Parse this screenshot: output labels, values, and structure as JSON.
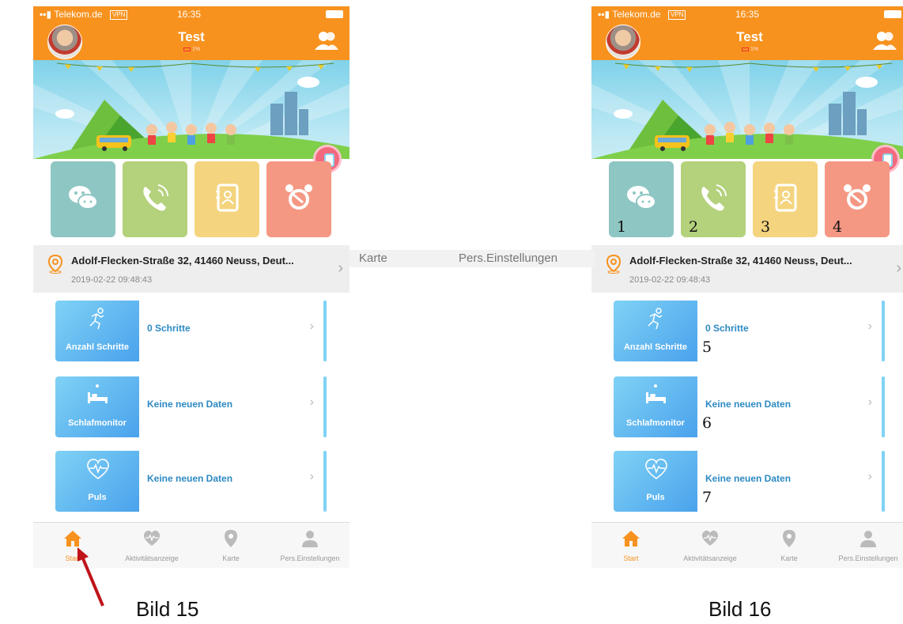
{
  "screens": [
    {
      "status_bar": {
        "carrier": "Telekom.de",
        "vpn": "VPN",
        "time": "16:35"
      },
      "header": {
        "title": "Test",
        "battery_text": "1%"
      },
      "tiles": [
        {
          "icon": "chat-icon",
          "num": ""
        },
        {
          "icon": "phone-icon",
          "num": ""
        },
        {
          "icon": "contacts-book-icon",
          "num": ""
        },
        {
          "icon": "alarm-clock-icon",
          "num": ""
        }
      ],
      "location": {
        "address": "Adolf-Flecken-Straße 32, 41460 Neuss, Deut...",
        "datetime": "2019-02-22 09:48:43"
      },
      "cards": [
        {
          "label": "Anzahl Schritte",
          "value": "0 Schritte",
          "icon": "running-icon",
          "num": ""
        },
        {
          "label": "Schlafmonitor",
          "value": "Keine neuen Daten",
          "icon": "bed-icon",
          "num": ""
        },
        {
          "label": "Puls",
          "value": "Keine neuen Daten",
          "icon": "heart-pulse-icon",
          "num": ""
        }
      ],
      "tabs": [
        "Start",
        "Aktivitätsanzeige",
        "Karte",
        "Pers.Einstellungen"
      ],
      "active_tab": "Start"
    },
    {
      "status_bar": {
        "carrier": "Telekom.de",
        "vpn": "VPN",
        "time": "16:35"
      },
      "header": {
        "title": "Test",
        "battery_text": "1%"
      },
      "tiles": [
        {
          "icon": "chat-icon",
          "num": "1"
        },
        {
          "icon": "phone-icon",
          "num": "2"
        },
        {
          "icon": "contacts-book-icon",
          "num": "3"
        },
        {
          "icon": "alarm-clock-icon",
          "num": "4"
        }
      ],
      "location": {
        "address": "Adolf-Flecken-Straße 32, 41460 Neuss, Deut...",
        "datetime": "2019-02-22 09:48:43"
      },
      "cards": [
        {
          "label": "Anzahl Schritte",
          "value": "0 Schritte",
          "icon": "running-icon",
          "num": "5"
        },
        {
          "label": "Schlafmonitor",
          "value": "Keine neuen Daten",
          "icon": "bed-icon",
          "num": "6"
        },
        {
          "label": "Puls",
          "value": "Keine neuen Daten",
          "icon": "heart-pulse-icon",
          "num": "7"
        }
      ],
      "tabs": [
        "Start",
        "Aktivitätsanzeige",
        "Karte",
        "Pers.Einstellungen"
      ],
      "active_tab": "Start"
    }
  ],
  "stray_labels": {
    "karte": "Karte",
    "pers": "Pers.Einstellungen"
  },
  "captions": {
    "left": "Bild 15",
    "right": "Bild 16"
  },
  "colors": {
    "accent": "#f7921e",
    "tile_chat": "#8ec6c3",
    "tile_phone": "#b4d17c",
    "tile_contacts": "#f4d47f",
    "tile_alarm": "#f59883",
    "card_blue": "#4aa2ec",
    "arrow": "#c0141a"
  }
}
